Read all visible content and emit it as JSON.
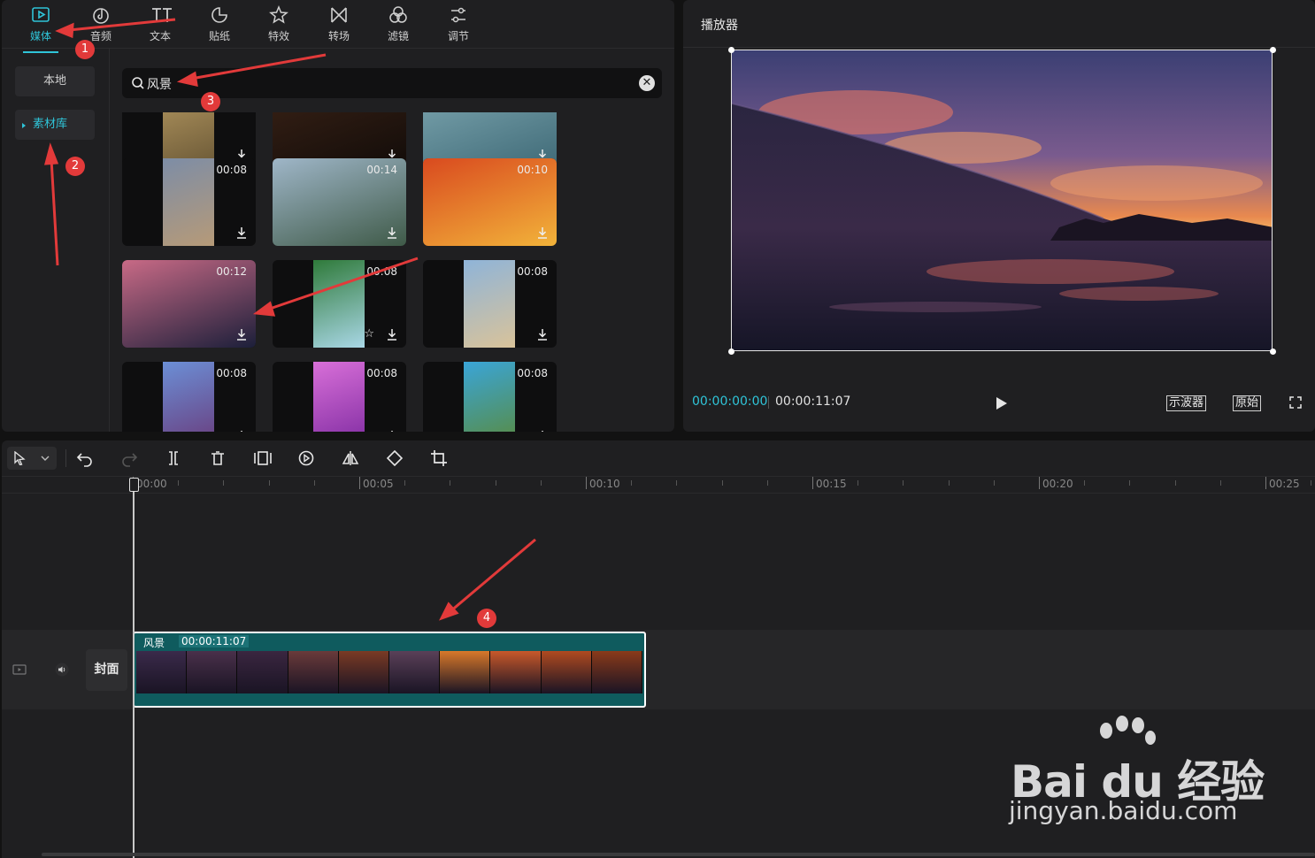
{
  "media_panel": {
    "tabs": [
      {
        "label": "媒体",
        "icon": "media-icon",
        "active": true
      },
      {
        "label": "音频",
        "icon": "audio-icon"
      },
      {
        "label": "文本",
        "icon": "text-icon"
      },
      {
        "label": "贴纸",
        "icon": "sticker-icon"
      },
      {
        "label": "特效",
        "icon": "effects-icon"
      },
      {
        "label": "转场",
        "icon": "transition-icon"
      },
      {
        "label": "滤镜",
        "icon": "filter-icon"
      },
      {
        "label": "调节",
        "icon": "adjust-icon"
      }
    ],
    "sidebar": {
      "local": "本地",
      "library": "素材库"
    },
    "search": {
      "value": "风景"
    },
    "cards": [
      {
        "duration": "",
        "colors": [
          "#b89b63",
          "#6a5836"
        ]
      },
      {
        "duration": "",
        "colors": [
          "#3a2216",
          "#120c09"
        ]
      },
      {
        "duration": "",
        "colors": [
          "#7fa8b2",
          "#3f6a77"
        ]
      },
      {
        "duration": "00:08",
        "colors": [
          "#7d8da6",
          "#b69a78"
        ]
      },
      {
        "duration": "00:14",
        "colors": [
          "#9fb6c8",
          "#3f5a48"
        ]
      },
      {
        "duration": "00:10",
        "colors": [
          "#d94a1f",
          "#f2b33a"
        ]
      },
      {
        "duration": "00:12",
        "colors": [
          "#c86a86",
          "#1c1f3a"
        ]
      },
      {
        "duration": "00:08",
        "colors": [
          "#2f7a3a",
          "#a9d7e6"
        ]
      },
      {
        "duration": "00:08",
        "colors": [
          "#8fb4d8",
          "#d9c39a"
        ]
      },
      {
        "duration": "00:08",
        "colors": [
          "#6b8fd6",
          "#6a3a7a"
        ]
      },
      {
        "duration": "00:08",
        "colors": [
          "#d86fd8",
          "#7d2aa0"
        ]
      },
      {
        "duration": "00:08",
        "colors": [
          "#3aa5d8",
          "#5a8a3a"
        ]
      }
    ]
  },
  "player": {
    "title": "播放器",
    "current_time": "00:00:00:00",
    "total_time": "00:00:11:07",
    "oscilloscope_label": "示波器",
    "original_label": "原始"
  },
  "timeline": {
    "ruler_labels": [
      "00:00",
      "00:05",
      "00:10",
      "00:15",
      "00:20",
      "00:25"
    ],
    "cover_label": "封面",
    "clip": {
      "name": "风景",
      "duration": "00:00:11:07"
    },
    "frame_colors": [
      "#3a2a4a",
      "#4a304a",
      "#3a2640",
      "#6a3a3a",
      "#7a3a24",
      "#5a4058",
      "#d8782a",
      "#c8582a",
      "#b04a20",
      "#8a3a1a"
    ]
  },
  "annotations": {
    "marker_1": "1",
    "marker_2": "2",
    "marker_3": "3",
    "marker_4": "4"
  },
  "watermark": {
    "brand": "Bai du 经验",
    "url": "jingyan.baidu.com"
  }
}
